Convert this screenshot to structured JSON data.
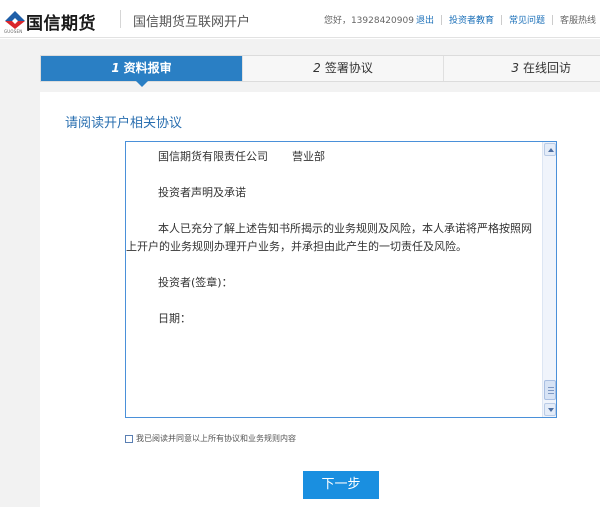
{
  "header": {
    "logo_text": "国信期货",
    "logo_sub": "GUOSEN",
    "site_title": "国信期货互联网开户",
    "greeting": "您好，13928420909",
    "logout": "退出",
    "links": [
      "投资者教育",
      "常见问题"
    ],
    "hotline": "客服热线"
  },
  "steps": [
    {
      "num": "1",
      "label": "资料报审"
    },
    {
      "num": "2",
      "label": "签署协议"
    },
    {
      "num": "3",
      "label": "在线回访"
    }
  ],
  "main": {
    "section_title": "请阅读开户相关协议",
    "agreement": {
      "company": "国信期货有限责任公司",
      "department": "营业部",
      "heading": "投资者声明及承诺",
      "body": "本人已充分了解上述告知书所揭示的业务规则及风险，本人承诺将严格按照网上开户的业务规则办理开户业务，并承担由此产生的一切责任及风险。",
      "signature": "投资者(签章)：",
      "date": "日期："
    },
    "confirm_label": "我已阅读并同意以上所有协议和业务规则内容",
    "next_button": "下一步"
  },
  "colors": {
    "accent": "#2a7fc4",
    "button": "#1a8fe0",
    "link": "#1a6fb8"
  }
}
